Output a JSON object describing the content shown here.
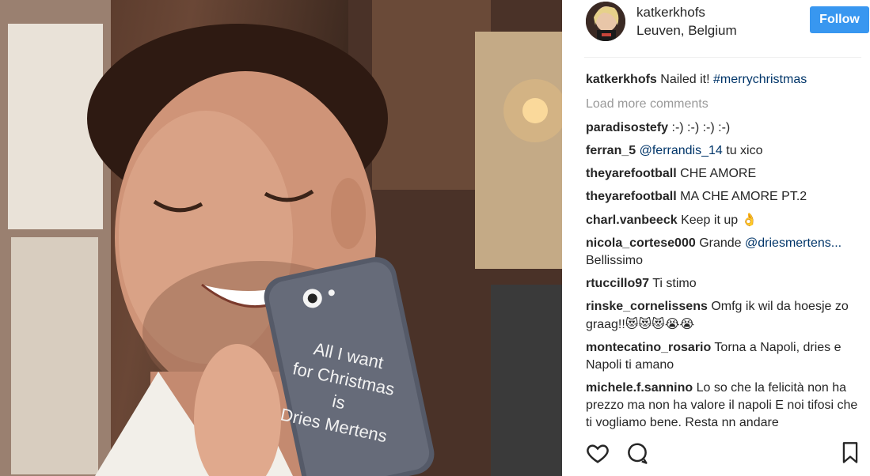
{
  "post": {
    "author": "katkerkhofs",
    "location": "Leuven, Belgium",
    "follow_label": "Follow",
    "accent_color": "#3897f0"
  },
  "photo": {
    "phone_case_text": [
      "All I want",
      "for Christmas",
      "is",
      "Dries Mertens"
    ]
  },
  "caption": {
    "user": "katkerkhofs",
    "text": "Nailed it!",
    "hashtag": "#merrychristmas"
  },
  "load_more_label": "Load more comments",
  "comments": [
    {
      "user": "paradisostefy",
      "text": ":-) :-) :-) :-)"
    },
    {
      "user": "ferran_5",
      "mention": "@ferrandis_14",
      "text": "tu xico"
    },
    {
      "user": "theyarefootball",
      "text": "CHE AMORE"
    },
    {
      "user": "theyarefootball",
      "text": "MA CHE AMORE PT.2"
    },
    {
      "user": "charl.vanbeeck",
      "text": "Keep it up",
      "emoji": "👌"
    },
    {
      "user": "nicola_cortese000",
      "text": "Grande",
      "mention": "@driesmertens...",
      "text2": "Bellissimo"
    },
    {
      "user": "rtuccillo97",
      "text": "Ti stimo"
    },
    {
      "user": "rinske_cornelissens",
      "text": "Omfg ik wil da hoesje zo graag!!",
      "emoji": "😻😻😻😭😭"
    },
    {
      "user": "montecatino_rosario",
      "text": "Torna a Napoli, dries e Napoli ti amano"
    },
    {
      "user": "michele.f.sannino",
      "text": "Lo so che la felicità non ha prezzo ma non ha valore il napoli E noi tifosi che ti vogliamo bene. Resta nn andare"
    }
  ],
  "icons": {
    "like": "heart-icon",
    "comment": "comment-icon",
    "save": "bookmark-icon"
  }
}
